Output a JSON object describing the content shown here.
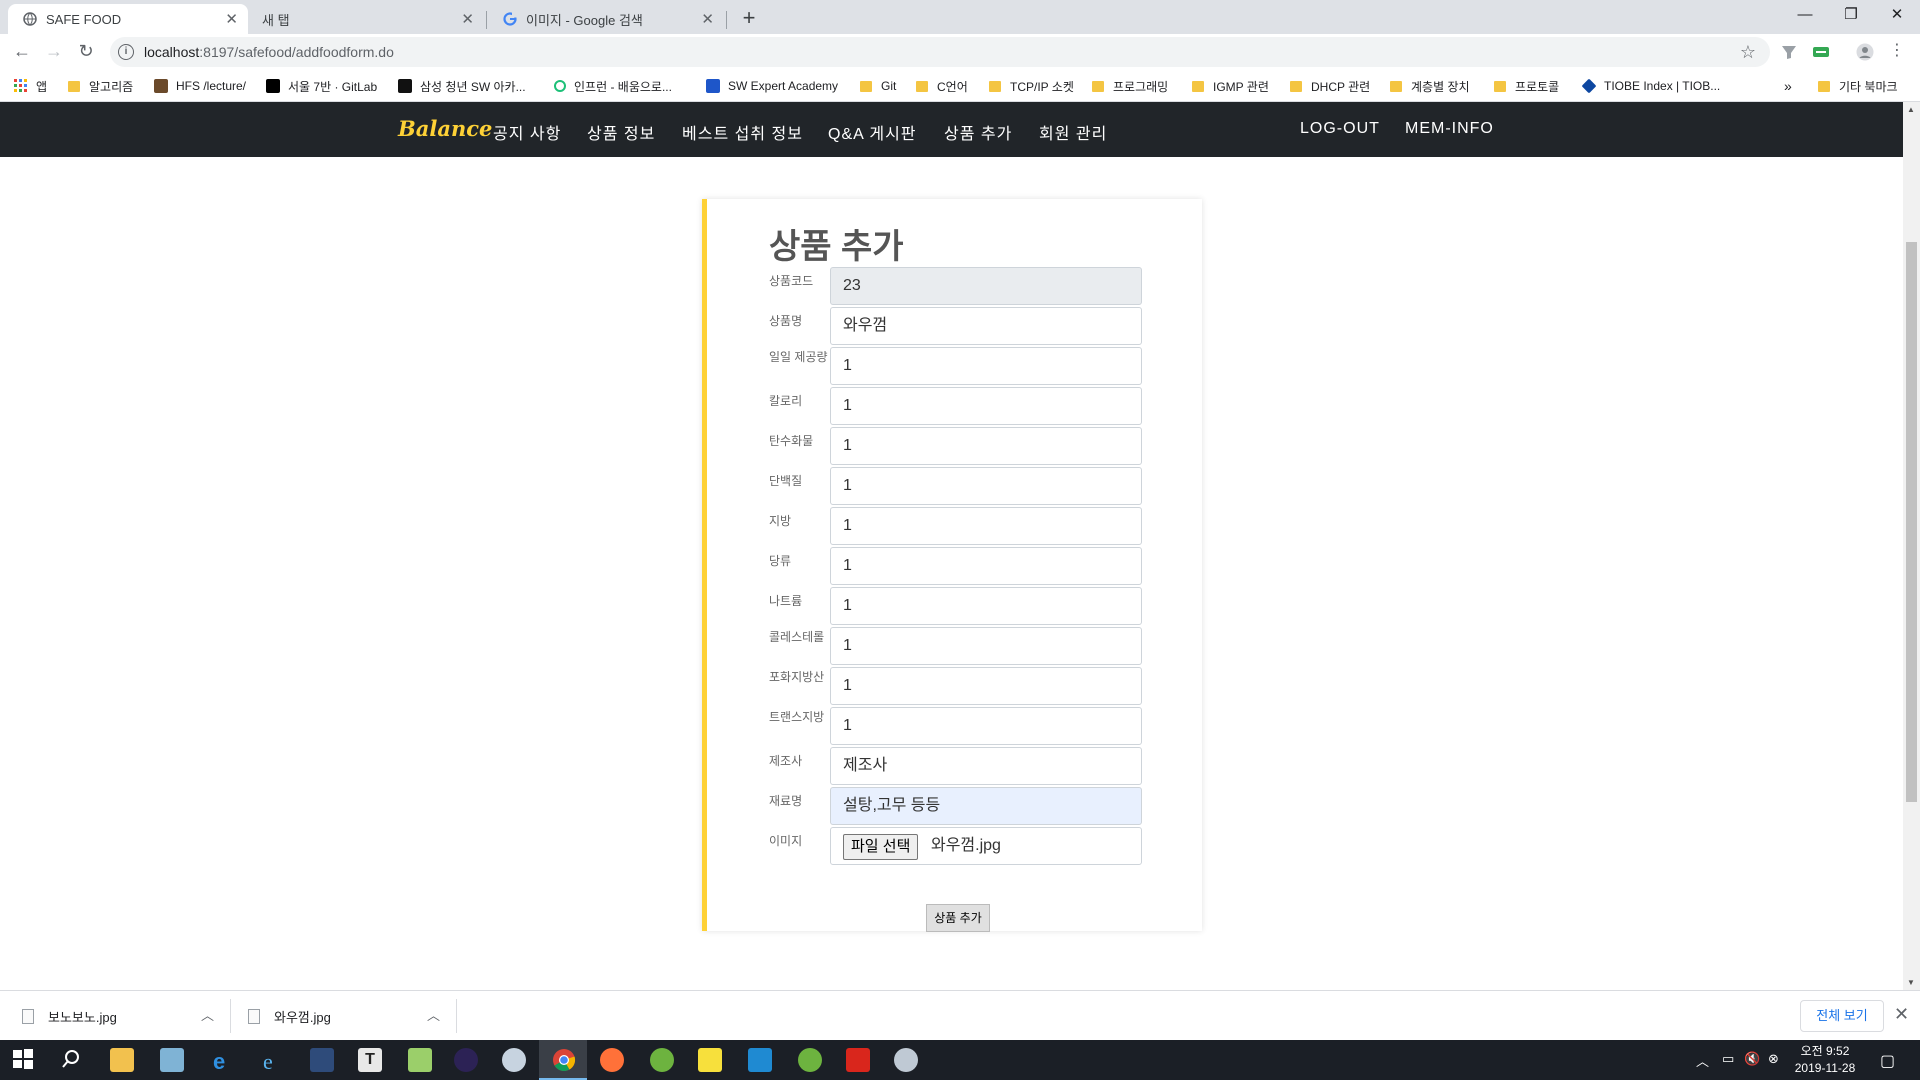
{
  "browser": {
    "tabs": [
      {
        "title": "SAFE FOOD",
        "active": true
      },
      {
        "title": "새 탭",
        "active": false
      },
      {
        "title": "이미지 - Google 검색",
        "active": false
      }
    ],
    "url_host": "localhost",
    "url_path": ":8197/safefood/addfoodform.do",
    "bookmarks": [
      {
        "label": "앱",
        "icon": "apps-grid-icon"
      },
      {
        "label": "알고리즘",
        "icon": "folder-icon"
      },
      {
        "label": "HFS /lecture/",
        "icon": "hfs-icon"
      },
      {
        "label": "서울 7반 · GitLab",
        "icon": "gitlab-icon"
      },
      {
        "label": "삼성 청년 SW 아카...",
        "icon": "ssafy-icon"
      },
      {
        "label": "인프런 - 배움으로...",
        "icon": "inflearn-icon"
      },
      {
        "label": "SW Expert Academy",
        "icon": "swea-icon"
      },
      {
        "label": "Git",
        "icon": "folder-icon"
      },
      {
        "label": "C언어",
        "icon": "folder-icon"
      },
      {
        "label": "TCP/IP 소켓",
        "icon": "folder-icon"
      },
      {
        "label": "프로그래밍",
        "icon": "folder-icon"
      },
      {
        "label": "IGMP 관련",
        "icon": "folder-icon"
      },
      {
        "label": "DHCP 관련",
        "icon": "folder-icon"
      },
      {
        "label": "계층별 장치",
        "icon": "folder-icon"
      },
      {
        "label": "프로토콜",
        "icon": "folder-icon"
      },
      {
        "label": "TIOBE Index | TIOB...",
        "icon": "tiobe-icon"
      }
    ],
    "bookmarks_more": "»",
    "other_bookmarks": "기타 북마크"
  },
  "site": {
    "brand": "Balance",
    "nav_links": [
      "공지 사항",
      "상품 정보",
      "베스트 섭취 정보",
      "Q&A 게시판",
      "상품 추가",
      "회원 관리"
    ],
    "nav_right": [
      "LOG-OUT",
      "MEM-INFO"
    ],
    "accent_color": "#fed136",
    "nav_bg_color": "#212529"
  },
  "form": {
    "title": "상품 추가",
    "fields": [
      {
        "label": "상품코드",
        "value": "23",
        "readonly": true
      },
      {
        "label": "상품명",
        "value": "와우껌"
      },
      {
        "label": "일일 제공량",
        "value": "1"
      },
      {
        "label": "칼로리",
        "value": "1"
      },
      {
        "label": "탄수화물",
        "value": "1"
      },
      {
        "label": "단백질",
        "value": "1"
      },
      {
        "label": "지방",
        "value": "1"
      },
      {
        "label": "당류",
        "value": "1"
      },
      {
        "label": "나트륨",
        "value": "1"
      },
      {
        "label": "콜레스테롤",
        "value": "1"
      },
      {
        "label": "포화지방산",
        "value": "1"
      },
      {
        "label": "트랜스지방",
        "value": "1"
      },
      {
        "label": "제조사",
        "value": "제조사"
      },
      {
        "label": "재료명",
        "value": "설탕,고무 등등",
        "autofilled": true
      }
    ],
    "image_label": "이미지",
    "file_button": "파일 선택",
    "file_name": "와우껌.jpg",
    "submit_label": "상품 추가"
  },
  "downloads": {
    "items": [
      {
        "name": "보노보노.jpg"
      },
      {
        "name": "와우껌.jpg"
      }
    ],
    "show_all": "전체 보기"
  },
  "taskbar": {
    "apps": [
      "start-icon",
      "search-icon",
      "file-explorer-icon",
      "notepad-icon",
      "edge-icon",
      "ie-icon",
      "ssms-icon",
      "typora-icon",
      "editor-icon",
      "eclipse-icon",
      "paint-icon",
      "chrome-icon",
      "firefox-icon",
      "spring-icon",
      "sticky-notes-icon",
      "vscode-icon",
      "spring-tool-icon",
      "acrobat-icon",
      "snipping-icon"
    ],
    "clock_time": "오전 9:52",
    "clock_date": "2019-11-28"
  }
}
